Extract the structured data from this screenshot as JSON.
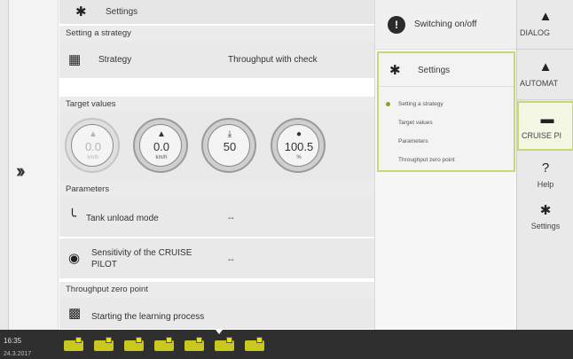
{
  "main": {
    "settings_title": "Settings",
    "strategy_section": "Setting a strategy",
    "strategy_label": "Strategy",
    "strategy_value": "Throughput with check",
    "target_section": "Target values",
    "gauges": [
      {
        "value": "0.0",
        "unit": "km/h",
        "icon": "speed-icon",
        "disabled": true
      },
      {
        "value": "0.0",
        "unit": "km/h",
        "icon": "speed-icon",
        "disabled": false
      },
      {
        "value": "50",
        "unit": "",
        "icon": "crop-icon",
        "disabled": false
      },
      {
        "value": "100.5",
        "unit": "%",
        "icon": "throughput-icon",
        "disabled": false
      }
    ],
    "parameters_section": "Parameters",
    "tank_unload_label": "Tank unload mode",
    "tank_unload_value": "--",
    "sensitivity_label_1": "Sensitivity of the CRUISE",
    "sensitivity_label_2": "PILOT",
    "sensitivity_value": "--",
    "zero_section": "Throughput zero point",
    "learning_label": "Starting the learning process"
  },
  "midmenu": {
    "switching": "Switching on/off",
    "settings": "Settings",
    "items": [
      "Setting a strategy",
      "Target values",
      "Parameters",
      "Throughput zero point"
    ]
  },
  "rightnav": {
    "items": [
      "DIALOG",
      "AUTOMAT",
      "CRUISE PI",
      "Help",
      "Settings"
    ]
  },
  "taskbar": {
    "time": "16:35",
    "date": "24.3.2017"
  },
  "colors": {
    "accent": "#c9d67a",
    "active_dot": "#8aa51a",
    "taskbar": "#2f2f2f",
    "machine_yellow": "#c8c81e"
  }
}
